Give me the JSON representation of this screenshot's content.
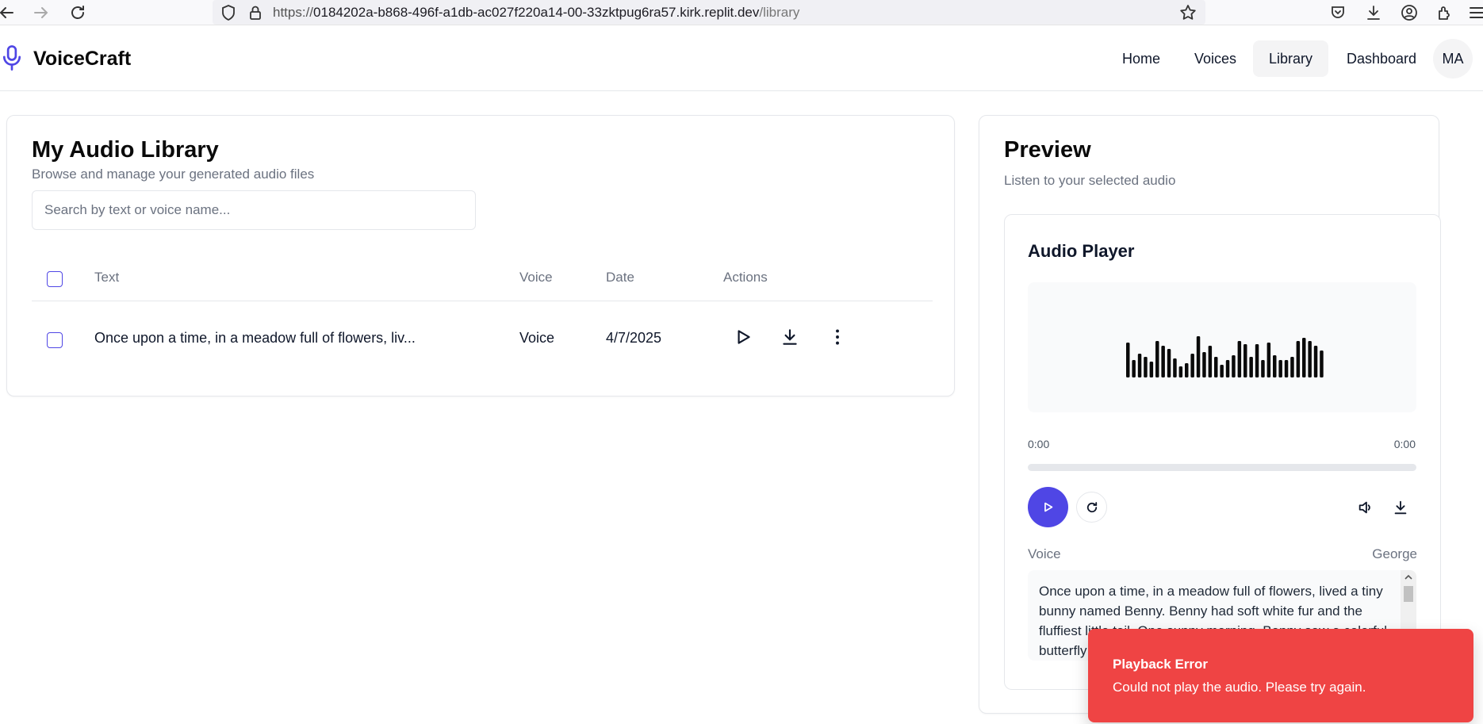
{
  "browser": {
    "url_scheme": "https://",
    "url_host": "0184202a-b868-496f-a1db-ac027f220a14-00-33zktpug6ra57.kirk.replit.dev",
    "url_path": "/library"
  },
  "header": {
    "brand": "VoiceCraft",
    "nav": [
      "Home",
      "Voices",
      "Library",
      "Dashboard"
    ],
    "active_nav": "Library",
    "avatar_initials": "MA"
  },
  "library": {
    "title": "My Audio Library",
    "subtitle": "Browse and manage your generated audio files",
    "search_placeholder": "Search by text or voice name...",
    "search_value": "",
    "columns": [
      "Text",
      "Voice",
      "Date",
      "Actions"
    ],
    "rows": [
      {
        "text": "Once upon a time, in a meadow full of flowers, liv...",
        "voice": "Voice",
        "date": "4/7/2025",
        "checked": false
      }
    ]
  },
  "preview": {
    "title": "Preview",
    "subtitle": "Listen to your selected audio",
    "player": {
      "title": "Audio Player",
      "current_time": "0:00",
      "duration": "0:00",
      "progress": 0,
      "voice_label": "Voice",
      "voice_value": "George",
      "text": "Once upon a time, in a meadow full of flowers, lived a tiny bunny named Benny. Benny had soft white fur and the fluffiest little tail. One sunny morning, Benny saw a colorful butterfly"
    }
  },
  "toast": {
    "title": "Playback Error",
    "message": "Could not play the audio. Please try again."
  },
  "colors": {
    "accent": "#4f46e5",
    "error": "#ef4444"
  }
}
